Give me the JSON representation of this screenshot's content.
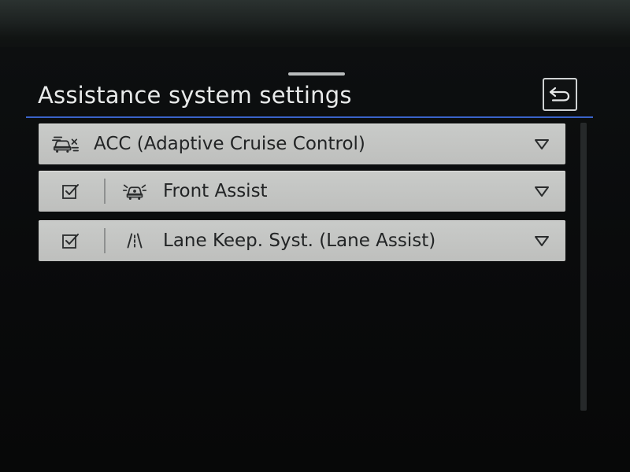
{
  "header": {
    "title": "Assistance system settings",
    "back_icon": "back-arrow-icon"
  },
  "rows": [
    {
      "label": "ACC (Adaptive Cruise Control)",
      "icon": "acc-car-icon",
      "has_checkbox": false,
      "expand_icon": "expand-triangle-icon"
    },
    {
      "label": "Front Assist",
      "icon": "front-assist-car-icon",
      "has_checkbox": true,
      "checked": true,
      "expand_icon": "expand-triangle-icon"
    },
    {
      "label": "Lane Keep. Syst. (Lane Assist)",
      "icon": "lane-assist-icon",
      "has_checkbox": true,
      "checked": true,
      "expand_icon": "expand-triangle-icon"
    }
  ],
  "colors": {
    "background": "#0a0b0b",
    "row_background": "#c4c6c4",
    "row_text": "#222425",
    "title_text": "#e8eaea",
    "accent_underline": "#3a63c9"
  }
}
